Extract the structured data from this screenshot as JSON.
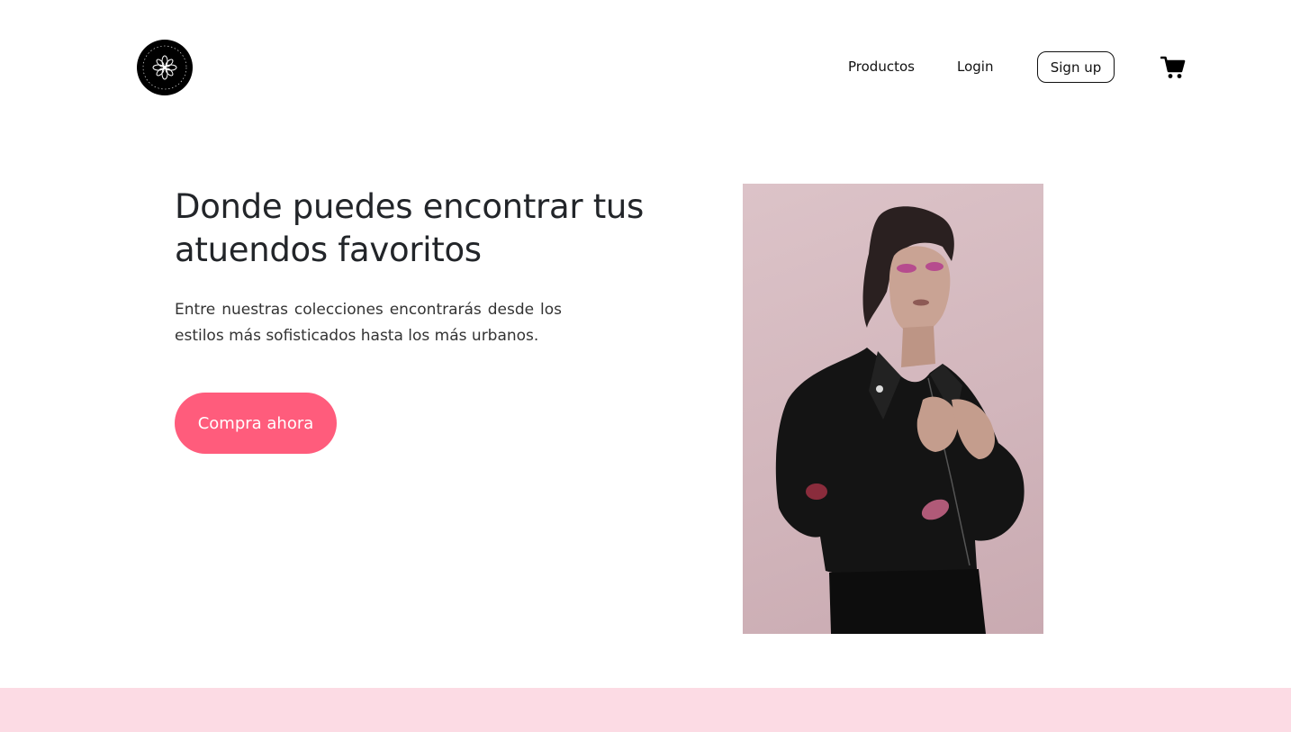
{
  "header": {
    "logo_icon": "flower-emblem-icon",
    "nav": {
      "productos_label": "Productos",
      "login_label": "Login",
      "signup_label": "Sign up"
    },
    "cart_icon": "shopping-cart-icon"
  },
  "hero": {
    "title": "Donde puedes encontrar tus atuendos favoritos",
    "description": "Entre nuestras colecciones encontrarás desde los estilos más sofisticados hasta los más urbanos.",
    "cta_label": "Compra ahora",
    "image_subject": "model-in-black-leather-jacket"
  },
  "colors": {
    "accent": "#ff5c7c",
    "band": "#fcdbe4",
    "text": "#222529",
    "photo_bg": "#d2b6bc"
  }
}
